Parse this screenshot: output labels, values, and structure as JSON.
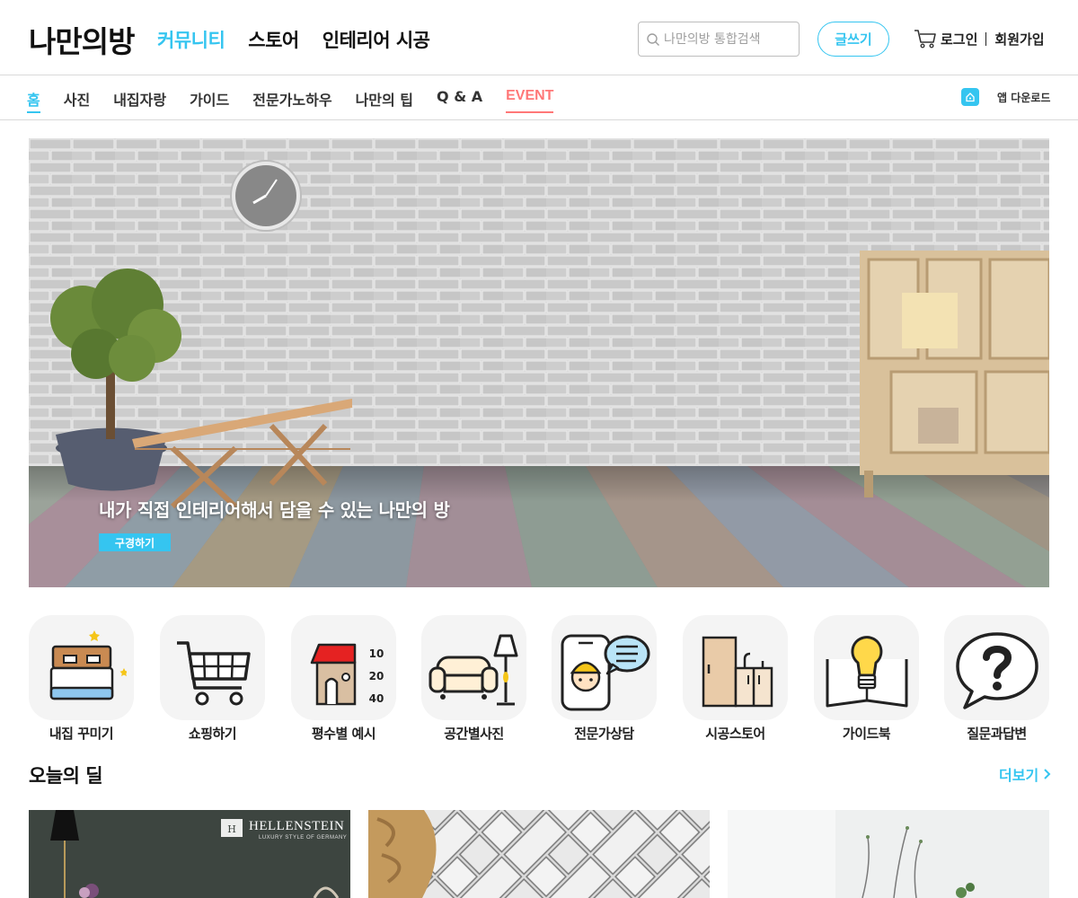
{
  "header": {
    "logo": "나만의방",
    "nav": [
      "커뮤니티",
      "스토어",
      "인테리어 시공"
    ],
    "search_placeholder": "나만의방 통합검색",
    "write_label": "글쓰기",
    "login_label": "로그인",
    "signup_label": "회원가입"
  },
  "sub_nav": {
    "items": [
      "홈",
      "사진",
      "내집자랑",
      "가이드",
      "전문가노하우",
      "나만의 팁",
      "Q & A",
      "EVENT"
    ],
    "app_download_label": "앱 다운로드"
  },
  "hero": {
    "caption": "내가 직접 인테리어해서 담을 수 있는 나만의 방",
    "button_label": "구경하기"
  },
  "categories": [
    {
      "label": "내집 꾸미기",
      "icon": "bed-icon"
    },
    {
      "label": "쇼핑하기",
      "icon": "cart-icon"
    },
    {
      "label": "평수별 예시",
      "icon": "house-icon"
    },
    {
      "label": "공간별사진",
      "icon": "sofa-lamp-icon"
    },
    {
      "label": "전문가상담",
      "icon": "phone-chat-icon"
    },
    {
      "label": "시공스토어",
      "icon": "cabinet-icon"
    },
    {
      "label": "가이드북",
      "icon": "lightbulb-book-icon"
    },
    {
      "label": "질문과답변",
      "icon": "question-bubble-icon"
    }
  ],
  "house_icon_numbers": [
    "10",
    "20",
    "40"
  ],
  "deal": {
    "title": "오늘의 딜",
    "more_label": "더보기",
    "brand": "HELLENSTEIN",
    "brand_tagline": "LUXURY STYLE OF GERMANY"
  },
  "colors": {
    "accent": "#35c5f0",
    "event": "#ff7777"
  }
}
